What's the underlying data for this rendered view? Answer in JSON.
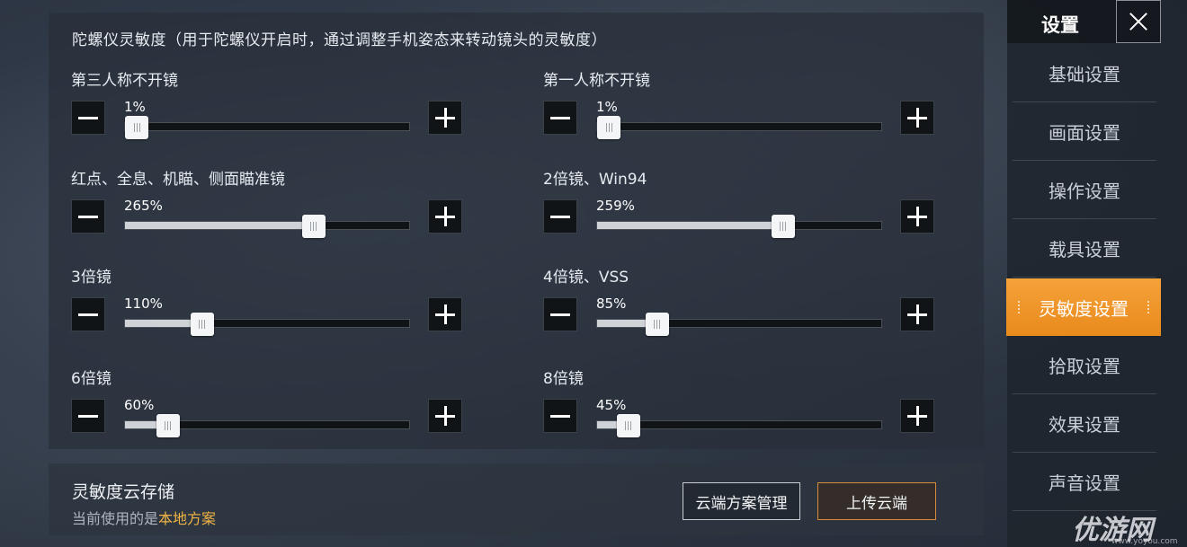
{
  "panel": {
    "title": "陀螺仪灵敏度（用于陀螺仪开启时，通过调整手机姿态来转动镜头的灵敏度）"
  },
  "sliders": [
    {
      "label": "第三人称不开镜",
      "value_text": "1%",
      "fraction": 0.0
    },
    {
      "label": "第一人称不开镜",
      "value_text": "1%",
      "fraction": 0.0
    },
    {
      "label": "红点、全息、机瞄、侧面瞄准镜",
      "value_text": "265%",
      "fraction": 0.66
    },
    {
      "label": "2倍镜、Win94",
      "value_text": "259%",
      "fraction": 0.65
    },
    {
      "label": "3倍镜",
      "value_text": "110%",
      "fraction": 0.27
    },
    {
      "label": "4倍镜、VSS",
      "value_text": "85%",
      "fraction": 0.21
    },
    {
      "label": "6倍镜",
      "value_text": "60%",
      "fraction": 0.15
    },
    {
      "label": "8倍镜",
      "value_text": "45%",
      "fraction": 0.11
    }
  ],
  "cloud": {
    "title": "灵敏度云存储",
    "current_prefix": "当前使用的是",
    "current_plan": "本地方案",
    "manage_label": "云端方案管理",
    "upload_label": "上传云端"
  },
  "sidebar": {
    "title": "设置",
    "items": [
      {
        "label": "基础设置",
        "active": false
      },
      {
        "label": "画面设置",
        "active": false
      },
      {
        "label": "操作设置",
        "active": false
      },
      {
        "label": "载具设置",
        "active": false
      },
      {
        "label": "灵敏度设置",
        "active": true
      },
      {
        "label": "拾取设置",
        "active": false
      },
      {
        "label": "效果设置",
        "active": false
      },
      {
        "label": "声音设置",
        "active": false
      }
    ]
  },
  "watermark": {
    "logo_text": "优游网",
    "url": "www.yoyou.com"
  },
  "colors": {
    "accent": "#f09a2b",
    "highlight_text": "#f2b545"
  }
}
